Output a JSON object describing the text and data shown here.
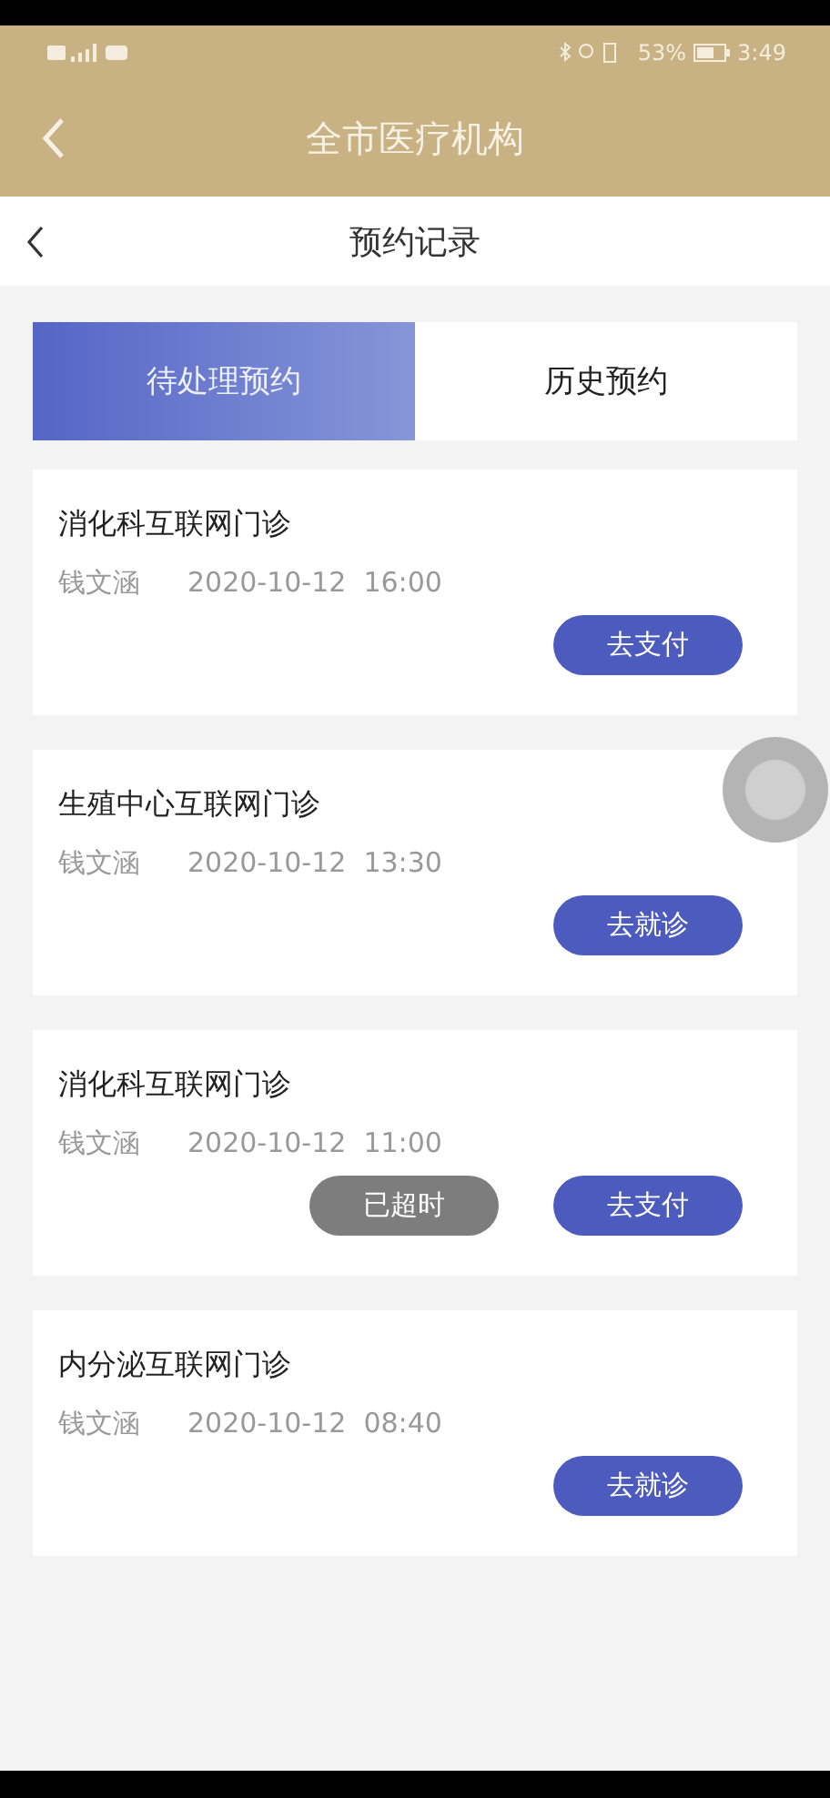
{
  "status_bar": {
    "battery_percent": "53%",
    "time": "3:49"
  },
  "header": {
    "title": "全市医疗机构"
  },
  "subheader": {
    "title": "预约记录"
  },
  "tabs": [
    {
      "label": "待处理预约",
      "selected": true
    },
    {
      "label": "历史预约",
      "selected": false
    }
  ],
  "appointments": [
    {
      "department": "消化科互联网门诊",
      "patient": "钱文涵",
      "datetime": "2020-10-12  16:00",
      "actions": [
        {
          "label": "去支付",
          "kind": "primary"
        }
      ]
    },
    {
      "department": "生殖中心互联网门诊",
      "patient": "钱文涵",
      "datetime": "2020-10-12  13:30",
      "actions": [
        {
          "label": "去就诊",
          "kind": "primary"
        }
      ]
    },
    {
      "department": "消化科互联网门诊",
      "patient": "钱文涵",
      "datetime": "2020-10-12  11:00",
      "actions": [
        {
          "label": "已超时",
          "kind": "expired"
        },
        {
          "label": "去支付",
          "kind": "primary"
        }
      ]
    },
    {
      "department": "内分泌互联网门诊",
      "patient": "钱文涵",
      "datetime": "2020-10-12  08:40",
      "actions": [
        {
          "label": "去就诊",
          "kind": "primary"
        }
      ]
    }
  ]
}
